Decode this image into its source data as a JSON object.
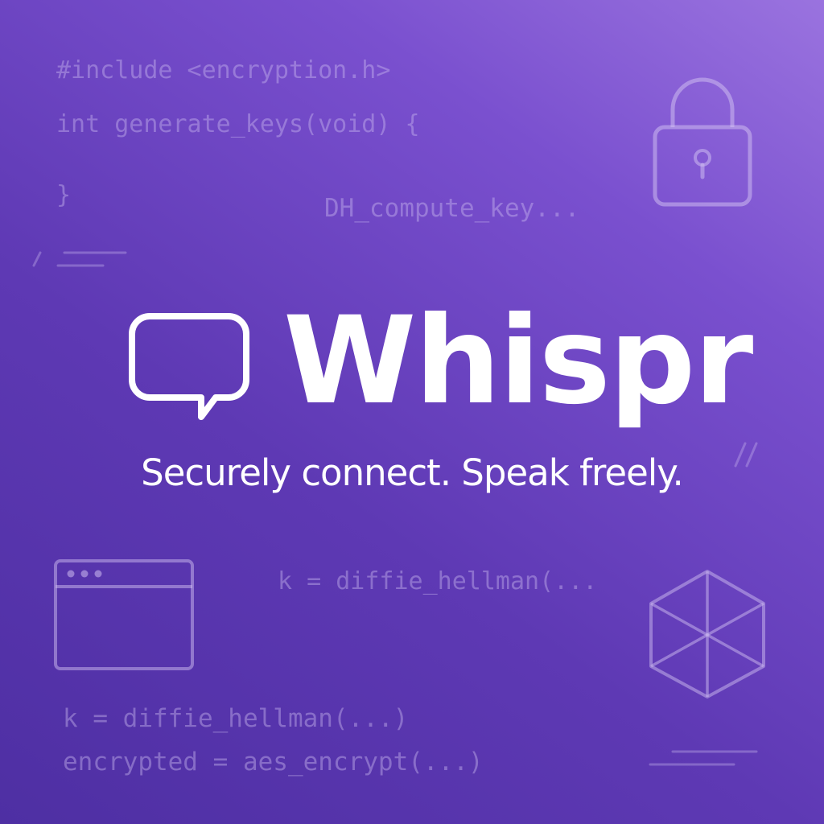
{
  "brand": {
    "name": "Whispr",
    "tagline": "Securely connect. Speak freely."
  },
  "code_snippets": {
    "include_line": "#include <encryption.h>",
    "function_line": "int generate_keys(void) {",
    "closing_brace": "}",
    "dh_compute": "DH_compute_key...",
    "diffie_mid": "k = diffie_hellman(...",
    "diffie_bottom": "k = diffie_hellman(...)",
    "aes_line": "encrypted = aes_encrypt(...)"
  },
  "icons": {
    "logo": "chat-bubble-icon",
    "lock": "padlock-icon",
    "window": "browser-window-icon",
    "cube": "hexagon-cube-icon"
  },
  "colors": {
    "background_start": "#4e2fa3",
    "background_end": "#9a73df",
    "foreground": "#ffffff",
    "code_text": "#cdbcf0"
  }
}
